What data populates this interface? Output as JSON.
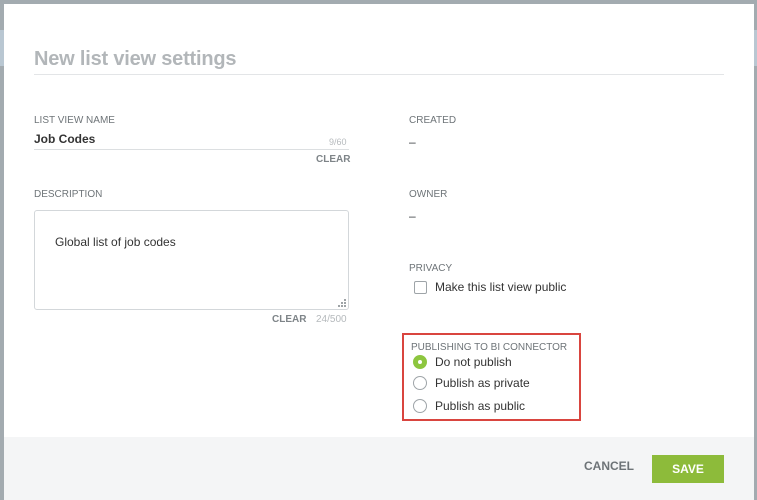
{
  "dialog": {
    "title": "New list view settings"
  },
  "list_view_name": {
    "label": "LIST VIEW NAME",
    "value": "Job Codes",
    "counter": "9/60",
    "clear_label": "CLEAR"
  },
  "description": {
    "label": "DESCRIPTION",
    "value": "Global list of job codes",
    "clear_label": "CLEAR",
    "counter": "24/500"
  },
  "created": {
    "label": "CREATED",
    "value": "–"
  },
  "owner": {
    "label": "OWNER",
    "value": "–"
  },
  "privacy": {
    "label": "PRIVACY",
    "checkbox_label": "Make this list view public",
    "checked": false
  },
  "publishing": {
    "label": "PUBLISHING TO BI CONNECTOR",
    "options": [
      {
        "label": "Do not publish",
        "selected": true
      },
      {
        "label": "Publish as private",
        "selected": false
      },
      {
        "label": "Publish as public",
        "selected": false
      }
    ]
  },
  "footer": {
    "cancel_label": "CANCEL",
    "save_label": "SAVE"
  },
  "colors": {
    "accent": "#8dbb3a",
    "highlight_border": "#d9453f"
  }
}
